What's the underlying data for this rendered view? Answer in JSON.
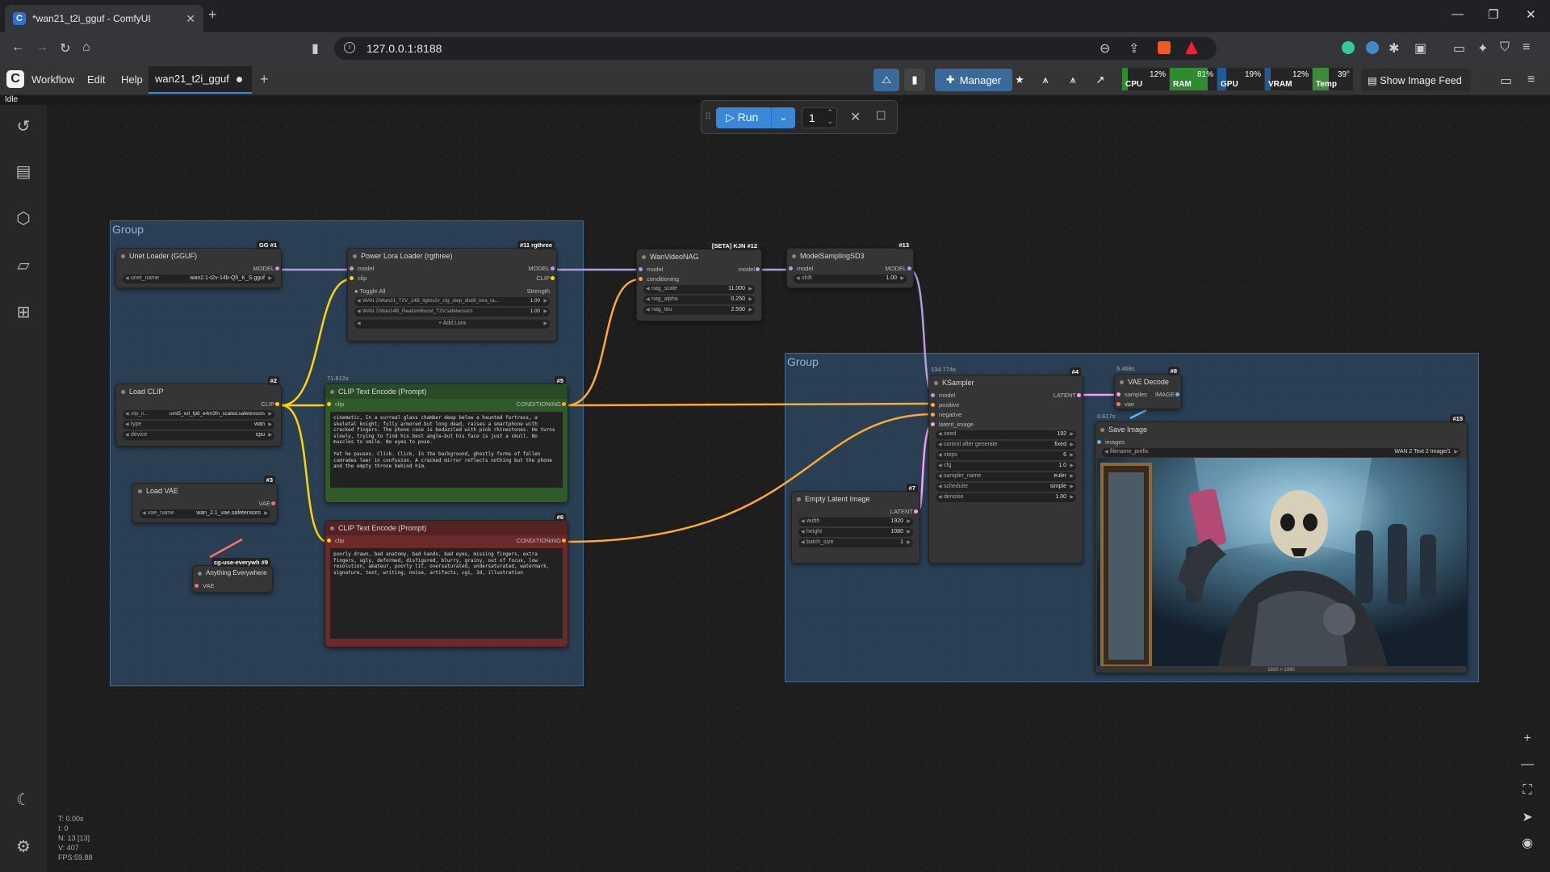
{
  "browser": {
    "tab_title": "*wan21_t2i_gguf - ComfyUI",
    "url": "127.0.0.1:8188"
  },
  "menu": {
    "items": [
      "Workflow",
      "Edit",
      "Help"
    ],
    "workflow_tab": "wan21_t2i_gguf",
    "manager_label": "Manager",
    "show_image_feed": "Show Image Feed",
    "status": "Idle"
  },
  "meters": {
    "cpu": {
      "label": "CPU",
      "value": "12%"
    },
    "ram": {
      "label": "RAM",
      "value": "81%"
    },
    "gpu": {
      "label": "GPU",
      "value": "19%"
    },
    "vram": {
      "label": "VRAM",
      "value": "12%"
    },
    "temp": {
      "label": "Temp",
      "value": "39°"
    }
  },
  "run": {
    "label": "Run",
    "count": "1"
  },
  "groups": {
    "left": "Group",
    "right": "Group"
  },
  "nodes": {
    "unet": {
      "title": "Unet Loader (GGUF)",
      "badge": "GG #1",
      "out": "MODEL",
      "w_label": "unet_name",
      "w_value": "wan2.1-t2v-14b-Q5_K_S.gguf"
    },
    "lora": {
      "title": "Power Lora Loader (rgthree)",
      "badge": "#11 rgthree",
      "in1": "model",
      "in2": "clip",
      "out1": "MODEL",
      "out2": "CLIP",
      "toggle": "Toggle All",
      "strength": "Strength",
      "lora1": "WAN 2\\Wan21_T2V_14B_lightx2v_cfg_step_distill_lora_ra...",
      "lora1_v": "1.00",
      "lora2": "WAN 2\\Wan14B_RealismBoost_T2V.safetensors",
      "lora2_v": "1.00",
      "add": "+ Add Lora"
    },
    "nag": {
      "title": "WanVideoNAG",
      "badge": "[SETA] KJN #12",
      "in1": "model",
      "in2": "conditioning",
      "out": "model",
      "w1": "nag_scale",
      "v1": "11.000",
      "w2": "nag_alpha",
      "v2": "0.250",
      "w3": "nag_tau",
      "v3": "2.500"
    },
    "msd3": {
      "title": "ModelSamplingSD3",
      "badge": "#13",
      "in": "model",
      "out": "MODEL",
      "w": "shift",
      "v": "1.00"
    },
    "clip": {
      "title": "Load CLIP",
      "badge": "#2",
      "out": "CLIP",
      "w1": "clip_n...",
      "v1": "umt5_xxl_fp8_e4m3fn_scaled.safetensors",
      "w2": "type",
      "v2": "wan",
      "w3": "device",
      "v3": "cpu"
    },
    "pos": {
      "title": "CLIP Text Encode (Prompt)",
      "badge": "#5",
      "timer": "71.612s",
      "in": "clip",
      "out": "CONDITIONING",
      "text": "cinematic, In a surreal glass chamber deep below a haunted fortress, a skeletal knight, fully armored but long dead, raises a smartphone with cracked fingers. The phone case is bedazzled with pink rhinestones. He turns slowly, trying to find his best angle—but his face is just a skull. No muscles to smile. No eyes to pose.\n\nYet he pauses. Click. Click. In the background, ghostly forms of fallen comrades leer in confusion. A cracked mirror reflects nothing but the phone and the empty throne behind him."
    },
    "neg": {
      "title": "CLIP Text Encode (Prompt)",
      "badge": "#6",
      "in": "clip",
      "out": "CONDITIONING",
      "text": "poorly drawn, bad anatomy, bad hands, bad eyes, missing fingers, extra fingers, ugly, deformed, disfigured, blurry, grainy, out of focus, low resolution, amateur, poorly lit, oversaturated, undersaturated, watermark, signature, text, writing, noise, artifacts, cgi, 3d, illustration"
    },
    "vae": {
      "title": "Load VAE",
      "badge": "#3",
      "out": "VAE",
      "w": "vae_name",
      "v": "wan_2.1_vae.safetensors"
    },
    "anything": {
      "title": "Anything Everywhere",
      "badge": "cg-use-everywh #9",
      "in": "VAE"
    },
    "ksampler": {
      "title": "KSampler",
      "badge": "#4",
      "timer": "134.774s",
      "in1": "model",
      "in2": "positive",
      "in3": "negative",
      "in4": "latent_image",
      "out": "LATENT",
      "widgets": [
        [
          "seed",
          "192"
        ],
        [
          "control after generate",
          "fixed"
        ],
        [
          "steps",
          "6"
        ],
        [
          "cfg",
          "1.0"
        ],
        [
          "sampler_name",
          "euler"
        ],
        [
          "scheduler",
          "simple"
        ],
        [
          "denoise",
          "1.00"
        ]
      ]
    },
    "vaedecode": {
      "title": "VAE Decode",
      "badge": "#8",
      "timer": "6.468s",
      "in1": "samples",
      "in2": "vae",
      "out": "IMAGE"
    },
    "latent": {
      "title": "Empty Latent Image",
      "badge": "#7",
      "out": "LATENT",
      "widgets": [
        [
          "width",
          "1920"
        ],
        [
          "height",
          "1080"
        ],
        [
          "batch_size",
          "1"
        ]
      ]
    },
    "save": {
      "title": "Save Image",
      "badge": "#15",
      "timer": "0.617s",
      "in": "images",
      "w": "filename_prefix",
      "v": "WAN 2 Text 2 Image/1",
      "size": "1920 × 1080"
    }
  },
  "stats": [
    "T: 0.00s",
    "I: 0",
    "N: 13 [13]",
    "V: 407",
    "FPS:59.88"
  ],
  "colors": {
    "accent": "#3a87d9",
    "model_link": "#b39ddb",
    "clip_link": "#ffd500",
    "cond_link": "#ffa931",
    "latent_link": "#ff9cf9",
    "vae_link": "#ff6e6e",
    "pos_node": "#2f5a2a",
    "neg_node": "#6a2a2a"
  }
}
